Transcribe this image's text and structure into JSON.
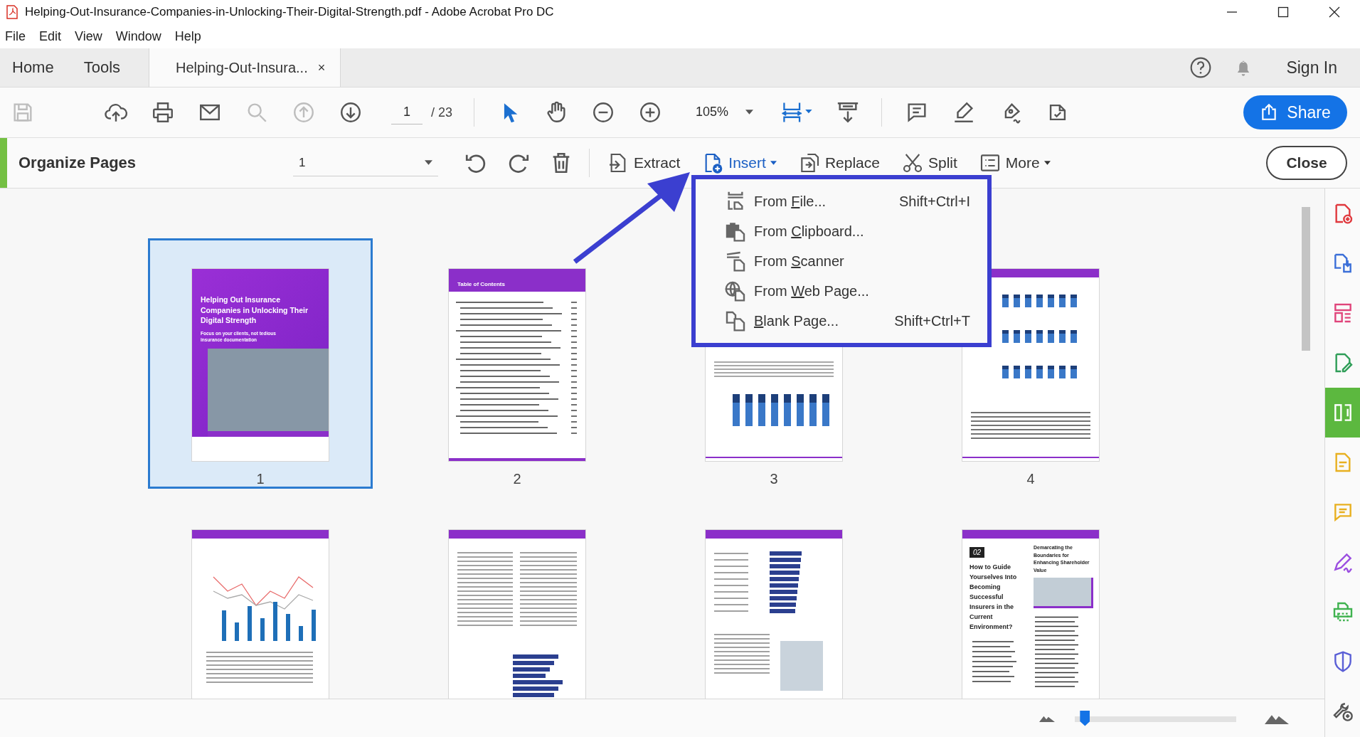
{
  "window": {
    "title": "Helping-Out-Insurance-Companies-in-Unlocking-Their-Digital-Strength.pdf - Adobe Acrobat Pro DC"
  },
  "menu_bar": [
    "File",
    "Edit",
    "View",
    "Window",
    "Help"
  ],
  "tabs": [
    {
      "label": "Home",
      "selected": false
    },
    {
      "label": "Tools",
      "selected": false
    },
    {
      "label": "Helping-Out-Insura...",
      "selected": true,
      "close": "×"
    }
  ],
  "account": {
    "sign_in": "Sign In"
  },
  "toolbar": {
    "file_tools": [
      {
        "kind": "save",
        "disabled": true
      },
      {
        "kind": "upload",
        "disabled": false
      },
      {
        "kind": "print",
        "disabled": false
      },
      {
        "kind": "mail",
        "disabled": false
      },
      {
        "kind": "zoom-search",
        "disabled": true
      },
      {
        "kind": "page-up",
        "disabled": true
      },
      {
        "kind": "page-down",
        "disabled": false
      }
    ],
    "page_number": "1",
    "page_total": "/ 23",
    "view_tools": [
      {
        "kind": "select",
        "selected": true
      },
      {
        "kind": "hand",
        "selected": false
      },
      {
        "kind": "zoom-out",
        "selected": false
      },
      {
        "kind": "zoom-in",
        "selected": false
      }
    ],
    "zoom": "105%",
    "comment_tools": [
      {
        "kind": "comment"
      },
      {
        "kind": "highlight"
      },
      {
        "kind": "sign"
      },
      {
        "kind": "stamp"
      }
    ],
    "share": "Share"
  },
  "organize_bar": {
    "title": "Organize Pages",
    "page_range": "1",
    "tools": [
      {
        "kind": "rotate-left"
      },
      {
        "kind": "rotate-right"
      },
      {
        "kind": "delete"
      }
    ],
    "actions": [
      {
        "kind": "extract",
        "label": "Extract",
        "selected": false,
        "dropdown": false
      },
      {
        "kind": "insert",
        "label": "Insert",
        "selected": true,
        "dropdown": true
      },
      {
        "kind": "replace",
        "label": "Replace",
        "selected": false,
        "dropdown": false
      },
      {
        "kind": "split",
        "label": "Split",
        "selected": false,
        "dropdown": false
      },
      {
        "kind": "more",
        "label": "More",
        "selected": false,
        "dropdown": true
      }
    ],
    "close": "Close"
  },
  "insert_menu": [
    {
      "kind": "file",
      "before": "From ",
      "key": "F",
      "after": "ile...",
      "shortcut": "Shift+Ctrl+I"
    },
    {
      "kind": "clipboard",
      "before": "From ",
      "key": "C",
      "after": "lipboard..."
    },
    {
      "kind": "scanner",
      "before": "From ",
      "key": "S",
      "after": "canner"
    },
    {
      "kind": "web",
      "before": "From ",
      "key": "W",
      "after": "eb Page..."
    },
    {
      "kind": "blank",
      "key": "B",
      "after": "lank Page...",
      "shortcut": "Shift+Ctrl+T"
    }
  ],
  "pages": [
    {
      "kind": "cover",
      "number": "1",
      "selected": true,
      "title": "Helping Out Insurance Companies in Unlocking Their Digital Strength",
      "subtitle": "Focus on your clients, not tedious insurance documentation"
    },
    {
      "kind": "toc",
      "number": "2",
      "selected": false,
      "heading": "Table of Contents"
    },
    {
      "kind": "chart-report",
      "number": "3",
      "selected": false
    },
    {
      "kind": "charts",
      "number": "4",
      "selected": false
    },
    {
      "kind": "line-chart",
      "selected": false
    },
    {
      "kind": "text-columns",
      "selected": false
    },
    {
      "kind": "bar-list",
      "selected": false
    },
    {
      "kind": "section",
      "selected": false,
      "badge": "02",
      "title": "How to Guide Yourselves Into Becoming Successful Insurers in the Current Environment?",
      "subheading": "Demarcating the Boundaries for Enhancing Shareholder Value"
    }
  ],
  "sidebar": [
    {
      "kind": "create-pdf",
      "color": "#e0393e",
      "selected": false
    },
    {
      "kind": "export",
      "color": "#3b6fd8",
      "selected": false
    },
    {
      "kind": "layout",
      "color": "#e0457b",
      "selected": false
    },
    {
      "kind": "edit",
      "color": "#2e9d57",
      "selected": false
    },
    {
      "kind": "organize",
      "color": "#5cb83f",
      "selected": true
    },
    {
      "kind": "comment-doc",
      "color": "#e8b020",
      "selected": false
    },
    {
      "kind": "comment",
      "color": "#e8b020",
      "selected": false
    },
    {
      "kind": "sign",
      "color": "#9b4ee0",
      "selected": false
    },
    {
      "kind": "print",
      "color": "#3fb24f",
      "selected": false
    },
    {
      "kind": "protect",
      "color": "#5a5fd6",
      "selected": false
    },
    {
      "kind": "tools",
      "color": "#555555",
      "selected": false
    }
  ],
  "zoom_slider": {
    "level": 0.05
  }
}
